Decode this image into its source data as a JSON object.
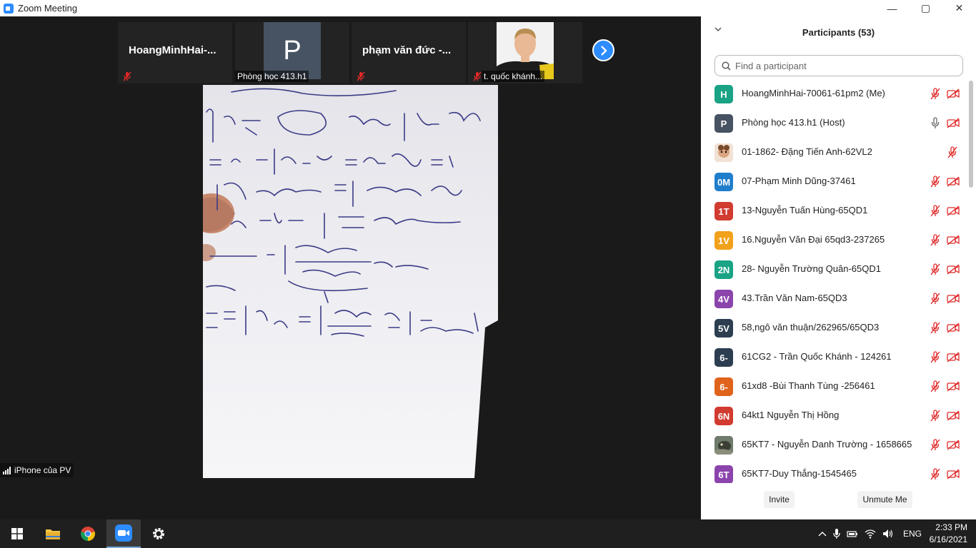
{
  "window": {
    "title": "Zoom Meeting",
    "minimize": "—",
    "maximize": "▢",
    "close": "✕"
  },
  "thumbnails": [
    {
      "name": "HoangMinhHai-..."
    },
    {
      "initial": "P",
      "label": "Phòng học 413.h1"
    },
    {
      "name": "phạm văn đức -..."
    },
    {
      "label": "t. quốc khánh..."
    }
  ],
  "speaker_label": "iPhone của PV",
  "panel": {
    "title": "Participants (53)",
    "search_placeholder": "Find a participant",
    "participants": [
      {
        "initials": "H",
        "color": "#1aa385",
        "name": "HoangMinhHai-70061-61pm2 (Me)"
      },
      {
        "initials": "P",
        "color": "#475363",
        "name": "Phòng học 413.h1 (Host)"
      },
      {
        "initials": "",
        "color": "#e8c3a8",
        "name": "01-1862- Đặng Tiến Anh-62VL2"
      },
      {
        "initials": "0M",
        "color": "#1f7ecb",
        "name": "07-Phạm Minh Dũng-37461"
      },
      {
        "initials": "1T",
        "color": "#d13b30",
        "name": "13-Nguyễn Tuấn Hùng-65QD1"
      },
      {
        "initials": "1V",
        "color": "#f2a11b",
        "name": "16.Nguyễn Văn Đại 65qd3-237265"
      },
      {
        "initials": "2N",
        "color": "#1aa385",
        "name": "28- Nguyễn Trường Quân-65QD1"
      },
      {
        "initials": "4V",
        "color": "#8b44ac",
        "name": "43.Trần Văn Nam-65QD3"
      },
      {
        "initials": "5V",
        "color": "#2c3e50",
        "name": "58,ngô văn thuận/262965/65QD3"
      },
      {
        "initials": "6-",
        "color": "#2c3e50",
        "name": "61CG2 - Trần Quốc Khánh - 124261"
      },
      {
        "initials": "6-",
        "color": "#e0631c",
        "name": "61xd8 -Bùi Thanh Tùng -256461"
      },
      {
        "initials": "6N",
        "color": "#d13b30",
        "name": "64kt1 Nguyễn Thị Hồng"
      },
      {
        "initials": "",
        "color": "#6d7b6a",
        "name": "65KT7 - Nguyễn Danh Trường - 1658665"
      },
      {
        "initials": "6T",
        "color": "#8b44ac",
        "name": "65KT7-Duy Thắng-1545465"
      }
    ],
    "invite": "Invite",
    "unmute": "Unmute Me"
  },
  "taskbar": {
    "lang": "ENG",
    "time": "2:33 PM",
    "date": "6/16/2021"
  }
}
